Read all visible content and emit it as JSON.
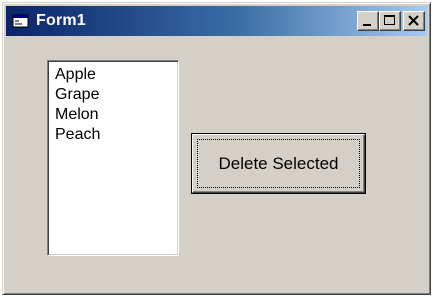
{
  "window": {
    "title": "Form1",
    "caption_buttons": [
      "minimize",
      "maximize",
      "close"
    ]
  },
  "listbox": {
    "items": [
      "Apple",
      "Grape",
      "Melon",
      "Peach"
    ]
  },
  "delete_button": {
    "label": "Delete Selected"
  },
  "colors": {
    "titlebar_start": "#0a246a",
    "titlebar_end": "#a6caf0",
    "face": "#d4d0c8"
  },
  "icons": {
    "app": "form-icon",
    "minimize": "minimize-icon",
    "maximize": "maximize-icon",
    "close": "close-icon"
  }
}
